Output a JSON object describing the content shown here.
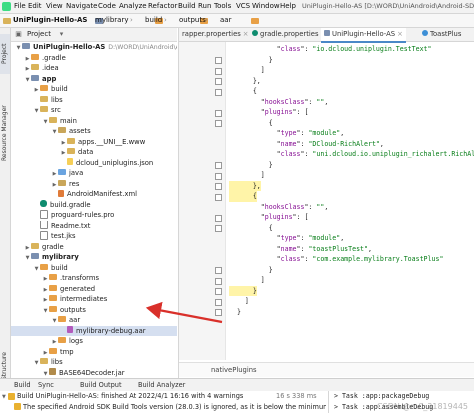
{
  "menubar": {
    "items": [
      "File",
      "Edit",
      "View",
      "Navigate",
      "Code",
      "Analyze",
      "Refactor",
      "Build",
      "Run",
      "Tools",
      "VCS",
      "Window",
      "Help"
    ],
    "title": "UniPlugin-Hello-AS [D:\\WORD\\UniAndroid\\Android-SDK"
  },
  "breadcrumb": [
    "UniPlugin-Hello-AS",
    "mylibrary",
    "build",
    "outputs",
    "aar"
  ],
  "leftstrip": {
    "project": "Project",
    "resource_manager": "Resource Manager",
    "structure": "Structure"
  },
  "project_panel": {
    "header": "Project",
    "rows": [
      {
        "depth": 0,
        "arrow": "▼",
        "icon": "module",
        "label": "UniPlugin-Hello-AS",
        "path": "D:\\WORD\\UniAndroid\\Android-SDK",
        "bold": true
      },
      {
        "depth": 1,
        "arrow": "▶",
        "icon": "folder-excl",
        "label": ".gradle"
      },
      {
        "depth": 1,
        "arrow": "▶",
        "icon": "folder",
        "label": ".idea"
      },
      {
        "depth": 1,
        "arrow": "▼",
        "icon": "module",
        "label": "app",
        "bold": true
      },
      {
        "depth": 2,
        "arrow": "▶",
        "icon": "folder-excl",
        "label": "build"
      },
      {
        "depth": 2,
        "arrow": "",
        "icon": "folder",
        "label": "libs"
      },
      {
        "depth": 2,
        "arrow": "▼",
        "icon": "folder",
        "label": "src"
      },
      {
        "depth": 3,
        "arrow": "▼",
        "icon": "folder",
        "label": "main"
      },
      {
        "depth": 4,
        "arrow": "▼",
        "icon": "folder-res",
        "label": "assets"
      },
      {
        "depth": 5,
        "arrow": "▶",
        "icon": "folder",
        "label": "apps.__UNI__E.www"
      },
      {
        "depth": 5,
        "arrow": "▶",
        "icon": "folder",
        "label": "data"
      },
      {
        "depth": 5,
        "arrow": "",
        "icon": "json",
        "label": "dcloud_uniplugins.json"
      },
      {
        "depth": 4,
        "arrow": "▶",
        "icon": "folder-java",
        "label": "java"
      },
      {
        "depth": 4,
        "arrow": "▶",
        "icon": "folder-res",
        "label": "res"
      },
      {
        "depth": 4,
        "arrow": "",
        "icon": "xml",
        "label": "AndroidManifest.xml"
      },
      {
        "depth": 2,
        "arrow": "",
        "icon": "gradle",
        "label": "build.gradle"
      },
      {
        "depth": 2,
        "arrow": "",
        "icon": "file",
        "label": "proguard-rules.pro"
      },
      {
        "depth": 2,
        "arrow": "",
        "icon": "file",
        "label": "Readme.txt"
      },
      {
        "depth": 2,
        "arrow": "",
        "icon": "file",
        "label": "test.jks"
      },
      {
        "depth": 1,
        "arrow": "▶",
        "icon": "folder",
        "label": "gradle"
      },
      {
        "depth": 1,
        "arrow": "▼",
        "icon": "module",
        "label": "mylibrary",
        "bold": true
      },
      {
        "depth": 2,
        "arrow": "▼",
        "icon": "folder-excl",
        "label": "build"
      },
      {
        "depth": 3,
        "arrow": "▶",
        "icon": "folder-excl",
        "label": ".transforms"
      },
      {
        "depth": 3,
        "arrow": "▶",
        "icon": "folder-excl",
        "label": "generated"
      },
      {
        "depth": 3,
        "arrow": "▶",
        "icon": "folder-excl",
        "label": "intermediates"
      },
      {
        "depth": 3,
        "arrow": "▼",
        "icon": "folder-excl",
        "label": "outputs"
      },
      {
        "depth": 4,
        "arrow": "▼",
        "icon": "folder-excl",
        "label": "aar"
      },
      {
        "depth": 5,
        "arrow": "",
        "icon": "aar",
        "label": "mylibrary-debug.aar",
        "selected": true
      },
      {
        "depth": 4,
        "arrow": "▶",
        "icon": "folder-excl",
        "label": "logs"
      },
      {
        "depth": 3,
        "arrow": "▶",
        "icon": "folder-excl",
        "label": "tmp"
      },
      {
        "depth": 2,
        "arrow": "▼",
        "icon": "folder",
        "label": "libs"
      },
      {
        "depth": 3,
        "arrow": "▼",
        "icon": "jar",
        "label": "BASE64Decoder.jar"
      },
      {
        "depth": 4,
        "arrow": "▶",
        "icon": "folder",
        "label": "Decoder"
      },
      {
        "depth": 4,
        "arrow": "▶",
        "icon": "folder",
        "label": "META-INF"
      },
      {
        "depth": 2,
        "arrow": "▼",
        "icon": "folder",
        "label": "src"
      }
    ]
  },
  "editor": {
    "tabs": [
      "rapper.properties",
      "gradle.properties",
      "UniPlugin-Hello-AS",
      "ToastPlus"
    ],
    "code_lines": [
      {
        "indent": 6,
        "parts": [
          [
            "p",
            "\""
          ],
          [
            "k",
            "class"
          ],
          [
            "p",
            "\": "
          ],
          [
            "s",
            "\"io.dcloud.uniplugin.TestText\""
          ]
        ]
      },
      {
        "indent": 5,
        "parts": [
          [
            "p",
            "}"
          ]
        ]
      },
      {
        "indent": 4,
        "parts": [
          [
            "p",
            "]"
          ]
        ]
      },
      {
        "indent": 3,
        "parts": [
          [
            "p",
            "},"
          ]
        ]
      },
      {
        "indent": 3,
        "parts": [
          [
            "p",
            "{"
          ]
        ]
      },
      {
        "indent": 4,
        "parts": [
          [
            "p",
            "\""
          ],
          [
            "k",
            "hooksClass"
          ],
          [
            "p",
            "\": "
          ],
          [
            "s",
            "\"\""
          ],
          [
            "p",
            ","
          ]
        ]
      },
      {
        "indent": 4,
        "parts": [
          [
            "p",
            "\""
          ],
          [
            "k",
            "plugins"
          ],
          [
            "p",
            "\": ["
          ]
        ]
      },
      {
        "indent": 5,
        "parts": [
          [
            "p",
            "{"
          ]
        ]
      },
      {
        "indent": 6,
        "parts": [
          [
            "p",
            "\""
          ],
          [
            "k",
            "type"
          ],
          [
            "p",
            "\": "
          ],
          [
            "s",
            "\"module\""
          ],
          [
            "p",
            ","
          ]
        ]
      },
      {
        "indent": 6,
        "parts": [
          [
            "p",
            "\""
          ],
          [
            "k",
            "name"
          ],
          [
            "p",
            "\": "
          ],
          [
            "s",
            "\"DCloud-RichAlert\""
          ],
          [
            "p",
            ","
          ]
        ]
      },
      {
        "indent": 6,
        "parts": [
          [
            "p",
            "\""
          ],
          [
            "k",
            "class"
          ],
          [
            "p",
            "\": "
          ],
          [
            "s",
            "\"uni.dcloud.io.uniplugin_richalert.RichAlertModul"
          ]
        ]
      },
      {
        "indent": 5,
        "parts": [
          [
            "p",
            "}"
          ]
        ]
      },
      {
        "indent": 4,
        "parts": [
          [
            "p",
            "]"
          ]
        ]
      },
      {
        "indent": 3,
        "parts": [
          [
            "p",
            "},"
          ]
        ],
        "hl": true
      },
      {
        "indent": 3,
        "parts": [
          [
            "p",
            "{"
          ]
        ],
        "hl": true
      },
      {
        "indent": 4,
        "parts": [
          [
            "p",
            "\""
          ],
          [
            "k",
            "hooksClass"
          ],
          [
            "p",
            "\": "
          ],
          [
            "s",
            "\"\""
          ],
          [
            "p",
            ","
          ]
        ]
      },
      {
        "indent": 4,
        "parts": [
          [
            "p",
            "\""
          ],
          [
            "k",
            "plugins"
          ],
          [
            "p",
            "\": ["
          ]
        ]
      },
      {
        "indent": 5,
        "parts": [
          [
            "p",
            "{"
          ]
        ]
      },
      {
        "indent": 6,
        "parts": [
          [
            "p",
            "\""
          ],
          [
            "k",
            "type"
          ],
          [
            "p",
            "\": "
          ],
          [
            "s",
            "\"module\""
          ],
          [
            "p",
            ","
          ]
        ]
      },
      {
        "indent": 6,
        "parts": [
          [
            "p",
            "\""
          ],
          [
            "k",
            "name"
          ],
          [
            "p",
            "\": "
          ],
          [
            "s",
            "\"toastPlusTest\""
          ],
          [
            "p",
            ","
          ]
        ]
      },
      {
        "indent": 6,
        "parts": [
          [
            "p",
            "\""
          ],
          [
            "k",
            "class"
          ],
          [
            "p",
            "\": "
          ],
          [
            "s",
            "\"com.example.mylibrary.ToastPlus\""
          ]
        ]
      },
      {
        "indent": 5,
        "parts": [
          [
            "p",
            "}"
          ]
        ]
      },
      {
        "indent": 4,
        "parts": [
          [
            "p",
            "]"
          ]
        ]
      },
      {
        "indent": 3,
        "parts": [
          [
            "p",
            "}"
          ]
        ],
        "hl": true
      },
      {
        "indent": 2,
        "parts": [
          [
            "p",
            "]"
          ]
        ]
      },
      {
        "indent": 1,
        "parts": [
          [
            "p",
            "}"
          ]
        ]
      }
    ],
    "footer": "nativePlugins"
  },
  "build_panel": {
    "tabs": [
      "Build",
      "Sync",
      "Build Output",
      "Build Analyzer"
    ],
    "line1": "Build UniPlugin-Hello-AS: finished At 2022/4/1 16:16 with 4 warnings",
    "line1_time": "16 s 338 ms",
    "line2": "The specified Android SDK Build Tools version (28.0.3) is ignored, as it is below the minimum s",
    "task1": "> Task :app:packageDebug",
    "task2": "> Task :app:assembleDebug"
  },
  "watermark": "CSDN @m0_31819445",
  "colors": {
    "selection": "#d5dff0",
    "annotation_arrow": "#d9302a",
    "highlight": "#fff4a8"
  }
}
